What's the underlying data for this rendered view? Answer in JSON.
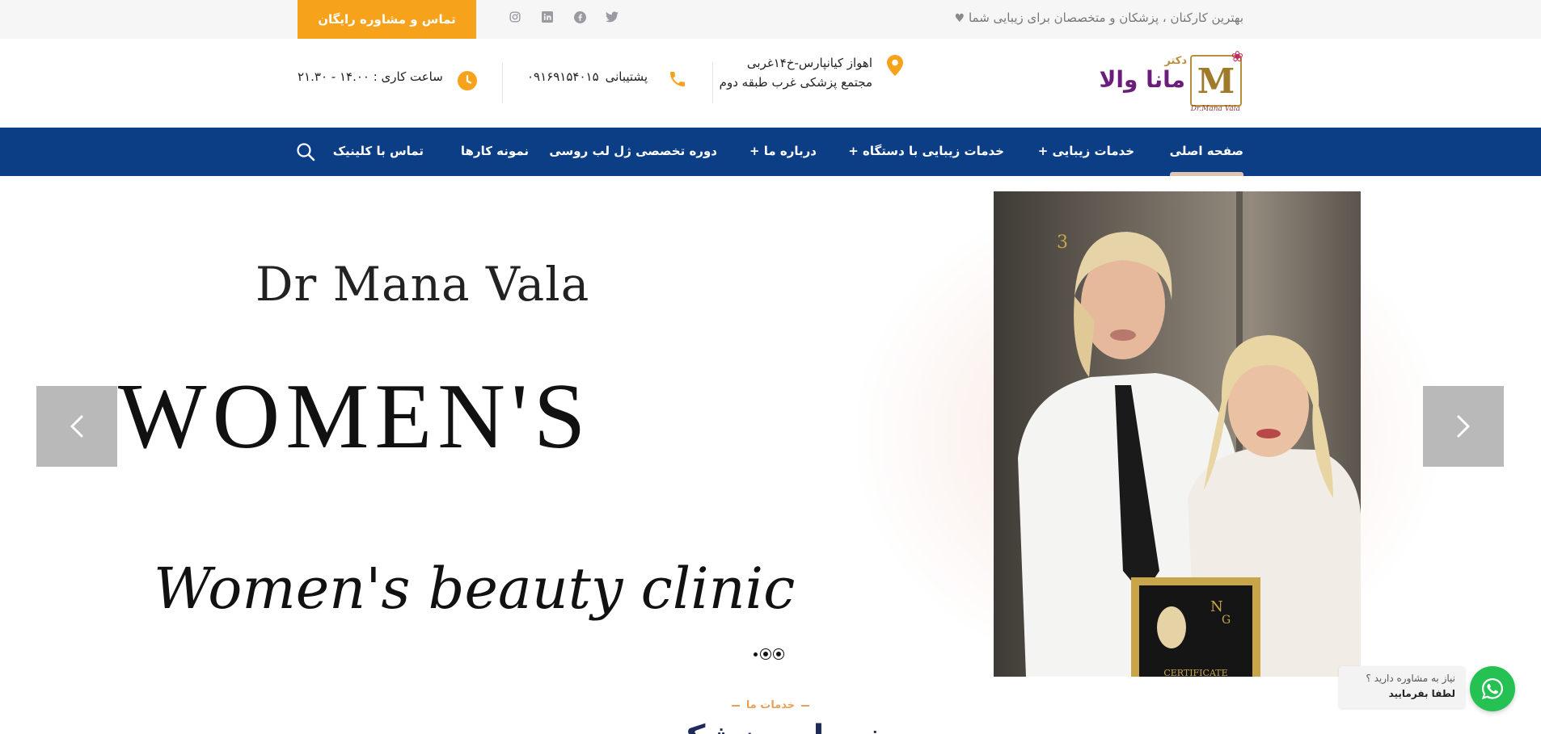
{
  "topbar": {
    "tagline": "بهترین کارکنان ، پزشکان و متخصصان برای زیبایی شما",
    "cta": "تماس و مشاوره رایگان",
    "social_icons": [
      "twitter-icon",
      "facebook-icon",
      "linkedin-icon",
      "instagram-icon"
    ]
  },
  "logo": {
    "monogram": "M",
    "title_small": "دکتر",
    "title_big": "مانا والا",
    "subtitle": "Dr.Mana Vala"
  },
  "contact": {
    "address": "اهواز کیانپارس-خ۱۴غربی مجتمع پزشکی غرب طبقه دوم",
    "support_label": "پشتیبانی",
    "phone": "۰۹۱۶۹۱۵۴۰۱۵",
    "hours": "ساعت کاری : ۱۴.۰۰ - ۲۱.۳۰"
  },
  "nav": {
    "items": [
      {
        "label": "صفحه اصلی",
        "active": true
      },
      {
        "label": "خدمات زیبایی +"
      },
      {
        "label": "خدمات زیبایی با دستگاه +"
      },
      {
        "label": "درباره ما +"
      },
      {
        "label": "دوره تخصصی ژل لب روسی"
      },
      {
        "label": "نمونه کارها"
      },
      {
        "label": "تماس با کلینیک"
      }
    ]
  },
  "hero": {
    "line1": "Dr Mana Vala",
    "line2": "WOMEN'S",
    "line3": "Women's beauty clinic",
    "photo_caption": "CERTIFICATE",
    "photo_number": "3",
    "slides": 3,
    "active_slide": 1
  },
  "section": {
    "kicker": "خدمات ما",
    "title": "خدمات پزشکی"
  },
  "whatsapp": {
    "line1": "نیاز به مشاوره دارید ؟",
    "line2": "لطفا بفرمایید"
  },
  "colors": {
    "accent_orange": "#f7a21b",
    "nav_blue": "#0c3e86",
    "whatsapp_green": "#25c152"
  }
}
